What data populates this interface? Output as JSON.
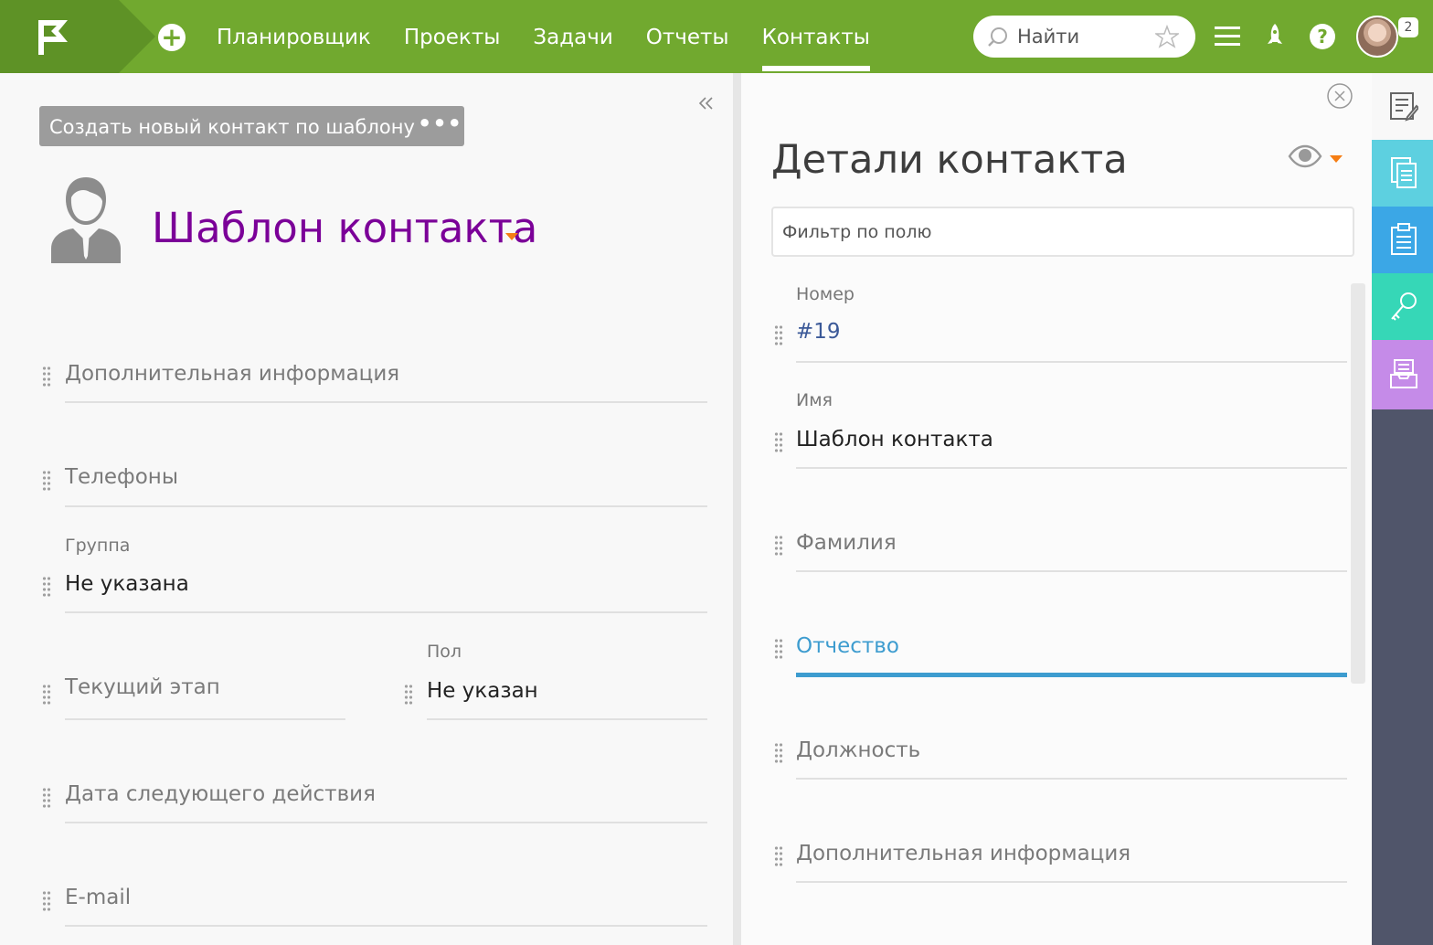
{
  "nav": {
    "items": [
      {
        "label": "Планировщик",
        "active": false
      },
      {
        "label": "Проекты",
        "active": false
      },
      {
        "label": "Задачи",
        "active": false
      },
      {
        "label": "Отчеты",
        "active": false
      },
      {
        "label": "Контакты",
        "active": true
      }
    ],
    "add_icon": "plus-circle-icon",
    "search_placeholder": "Найти",
    "notification_count": "2"
  },
  "colors": {
    "topbar": "#71a92f",
    "title": "#7b0098",
    "accent_caret": "#f57d14",
    "link": "#3b5998",
    "active_field": "#3d9ccf"
  },
  "left": {
    "create_template_button": "Создать новый контакт по шаблону",
    "more_button": "•••",
    "contact_title": "Шаблон контакта",
    "fields": {
      "additional_info": "Дополнительная информация",
      "phones": "Телефоны",
      "group_label": "Группа",
      "group_value": "Не указана",
      "current_stage": "Текущий этап",
      "gender_label": "Пол",
      "gender_value": "Не указан",
      "next_action_date": "Дата следующего действия",
      "email": "E-mail"
    }
  },
  "right": {
    "title": "Детали контакта",
    "filter_placeholder": "Фильтр по полю",
    "fields": {
      "number_label": "Номер",
      "number_value": "#19",
      "name_label": "Имя",
      "name_value": "Шаблон контакта",
      "surname": "Фамилия",
      "patronymic": "Отчество",
      "position": "Должность",
      "additional_info": "Дополнительная информация"
    }
  },
  "sidebar": {
    "tabs": [
      {
        "icon": "edit-note-icon",
        "color": "#f8f8f8"
      },
      {
        "icon": "documents-icon",
        "color": "#5dd0e0"
      },
      {
        "icon": "clipboard-icon",
        "color": "#3ba7e6"
      },
      {
        "icon": "key-icon",
        "color": "#36d7b7"
      },
      {
        "icon": "inbox-icon",
        "color": "#c58be8"
      }
    ]
  }
}
